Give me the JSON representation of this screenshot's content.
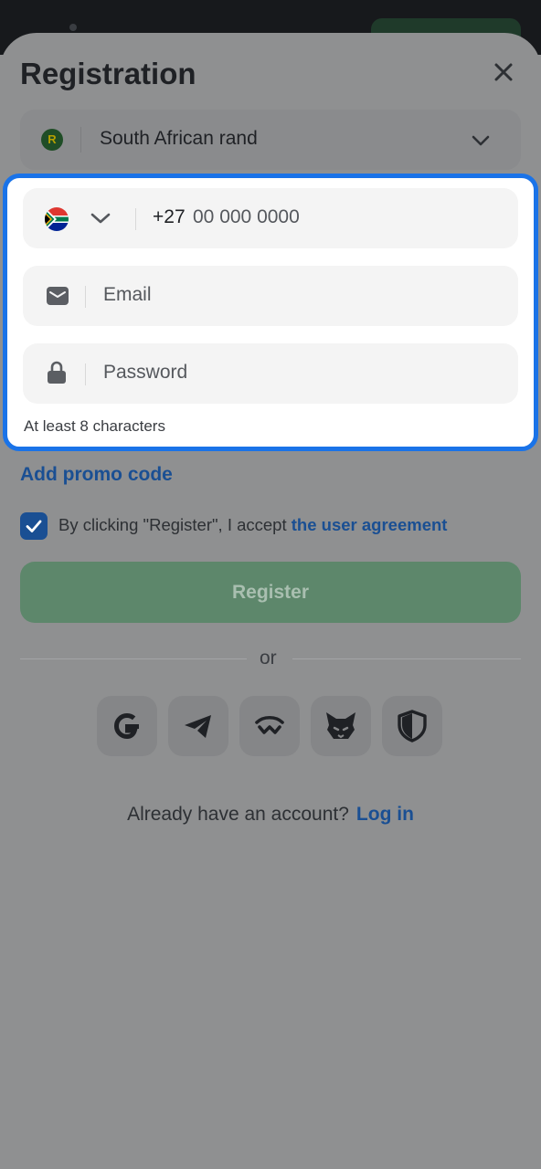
{
  "header": {
    "title": "Registration",
    "close_icon": "close-icon"
  },
  "currency": {
    "badge": "R",
    "label": "South African rand",
    "icon": "chevron-down-icon"
  },
  "form": {
    "phone": {
      "country_flag": "south-africa-flag-icon",
      "code": "+27",
      "placeholder": "00 000 0000"
    },
    "email": {
      "placeholder": "Email",
      "icon": "mail-icon"
    },
    "password": {
      "placeholder": "Password",
      "icon": "lock-icon",
      "hint": "At least 8 characters"
    }
  },
  "promo": {
    "label": "Add promo code"
  },
  "agreement": {
    "checked": true,
    "text": "By clicking \"Register\", I accept ",
    "link": "the user agreement"
  },
  "register_button": {
    "label": "Register"
  },
  "divider": {
    "label": "or"
  },
  "social_buttons": [
    "google-icon",
    "telegram-icon",
    "walletconnect-icon",
    "metamask-icon",
    "shield-icon"
  ],
  "login_prompt": {
    "text": "Already have an account?",
    "link": "Log in"
  },
  "colors": {
    "accent": "#1a73e8",
    "link": "#1a4f93",
    "register_bg": "#5d876b",
    "overlay": "#8f9091"
  }
}
